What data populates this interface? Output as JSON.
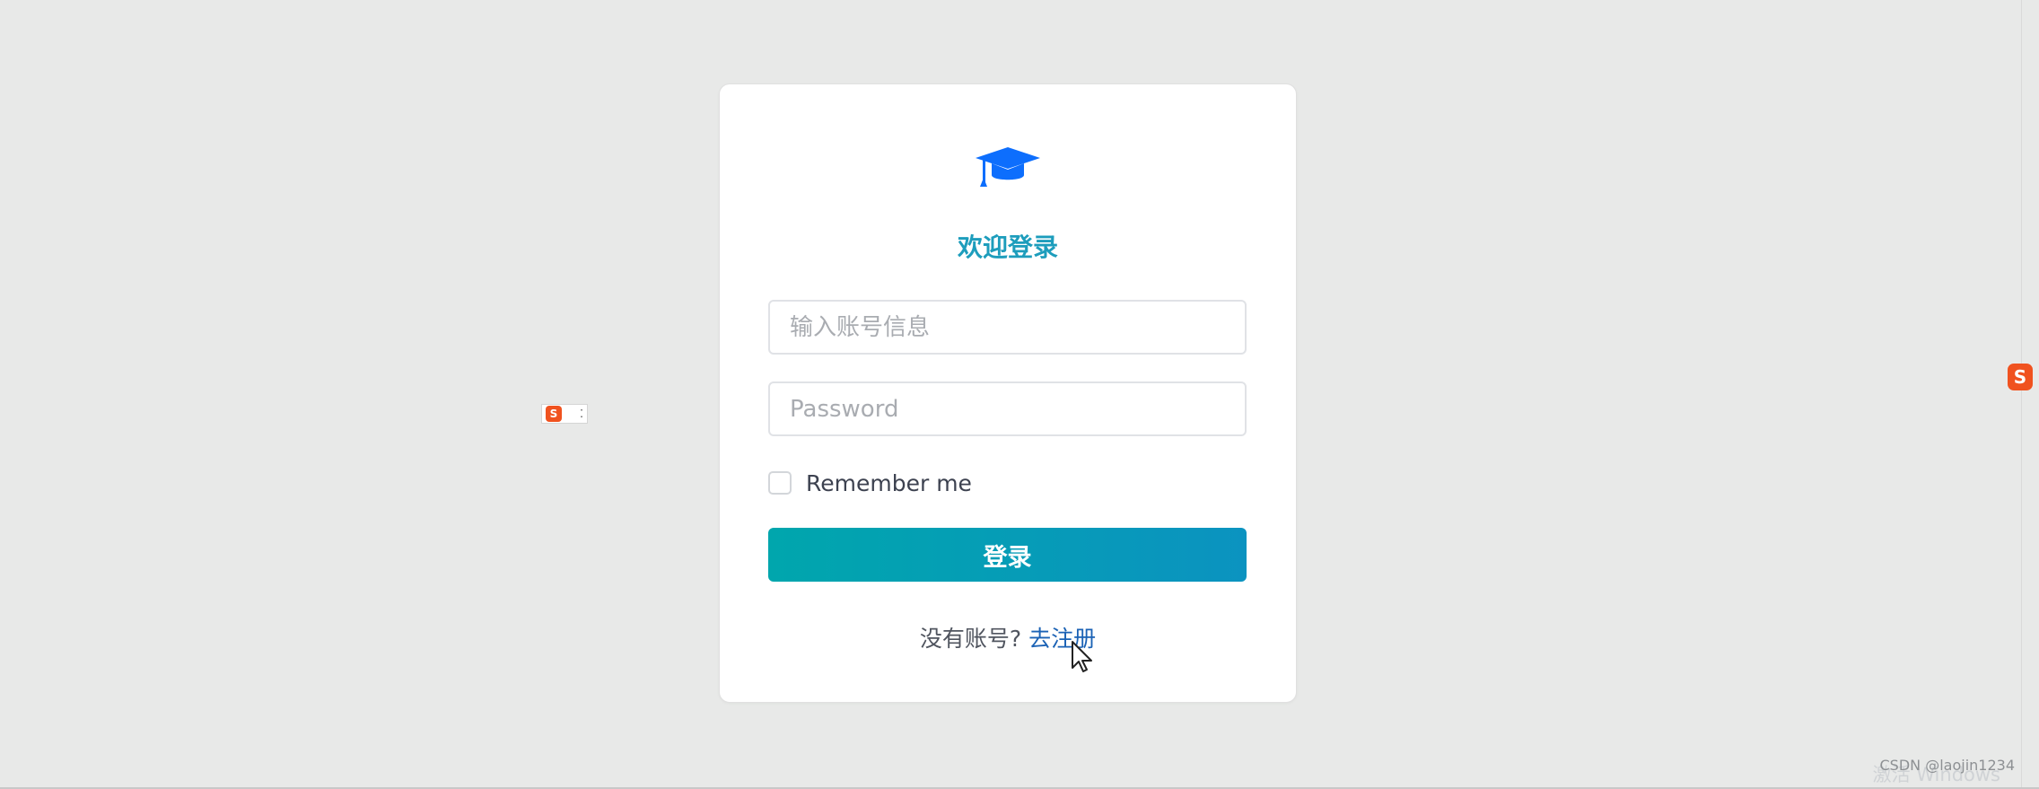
{
  "login": {
    "title": "欢迎登录",
    "account_placeholder": "输入账号信息",
    "password_placeholder": "Password",
    "remember_label": "Remember me",
    "submit_label": "登录",
    "register_prompt": "没有账号?",
    "register_link": "去注册"
  },
  "ime": {
    "badge": "S"
  },
  "watermark": {
    "activate_text": "激活 Windows",
    "csdn_text": "CSDN @laojin1234"
  },
  "colors": {
    "background": "#e8e9e8",
    "brand_blue": "#0d6efd",
    "title": "#1d9dbc",
    "button_start": "#00a6ad",
    "button_end": "#0b93c0",
    "link": "#1b62b5"
  },
  "icons": {
    "logo": "graduation-cap-icon",
    "cursor": "mouse-pointer-icon"
  }
}
